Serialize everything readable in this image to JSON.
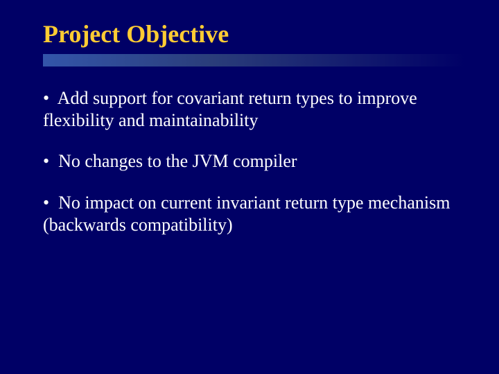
{
  "title": "Project Objective",
  "bullets": [
    {
      "mark": "•",
      "text": " Add support for covariant return types to improve flexibility and maintainability"
    },
    {
      "mark": "•",
      "text": " No changes to the JVM compiler"
    },
    {
      "mark": "•",
      "text": " No impact on current invariant return type mechanism (backwards compatibility)"
    }
  ]
}
